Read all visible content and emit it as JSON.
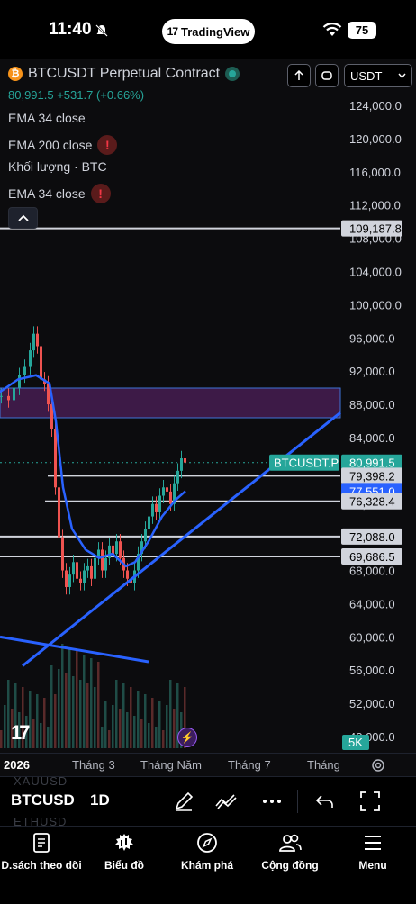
{
  "status": {
    "time": "11:40",
    "app_pill": "TradingView",
    "battery": "75"
  },
  "chart": {
    "symbol": "BTCUSDT Perpetual Contract",
    "price_line": "80,991.5 +531.7 (+0.66%)",
    "indicators": [
      {
        "label": "EMA 34 close",
        "warning": false
      },
      {
        "label": "EMA 200 close",
        "warning": true
      },
      {
        "label": "Khối lượng · BTC",
        "warning": false
      },
      {
        "label": "EMA 34 close",
        "warning": true
      }
    ],
    "currency": "USDT",
    "price_scale": [
      "124,000.0",
      "120,000.0",
      "116,000.0",
      "112,000.0",
      "108,000.0",
      "104,000.0",
      "100,000.0",
      "96,000.0",
      "92,000.0",
      "88,000.0",
      "84,000.0",
      "80,000.0",
      "76,000.0",
      "72,000.0",
      "68,000.0",
      "64,000.0",
      "60,000.0",
      "56,000.0",
      "52,000.0",
      "48,000.0"
    ],
    "price_tags": [
      {
        "value": "109,187.8",
        "style": "white"
      },
      {
        "value": "80,991.5",
        "style": "green"
      },
      {
        "value": "79,398.2",
        "style": "white"
      },
      {
        "value": "77,551.0",
        "style": "blue"
      },
      {
        "value": "76,328.4",
        "style": "white"
      },
      {
        "value": "72,088.0",
        "style": "white"
      },
      {
        "value": "69,686.5",
        "style": "white"
      }
    ],
    "last_price_label": "BTCUSDT.P",
    "volume_label": "5K",
    "colors": {
      "up": "#26a69a",
      "down": "#ef5350",
      "ema": "#2962ff",
      "zone": "#4a1f4f"
    }
  },
  "time_axis": {
    "labels": [
      "2026",
      "Tháng 3",
      "Tháng Năm",
      "Tháng 7",
      "Tháng"
    ]
  },
  "toolbar": {
    "symbol": "BTCUSD",
    "ghost_top": "XAUUSD",
    "ghost_bottom": "ETHUSD",
    "interval": "1D"
  },
  "tabs": [
    {
      "label": "D.sách theo dõi",
      "icon": "watchlist-icon"
    },
    {
      "label": "Biểu đồ",
      "icon": "chart-icon"
    },
    {
      "label": "Khám phá",
      "icon": "compass-icon"
    },
    {
      "label": "Cộng đồng",
      "icon": "community-icon"
    },
    {
      "label": "Menu",
      "icon": "menu-icon"
    }
  ]
}
